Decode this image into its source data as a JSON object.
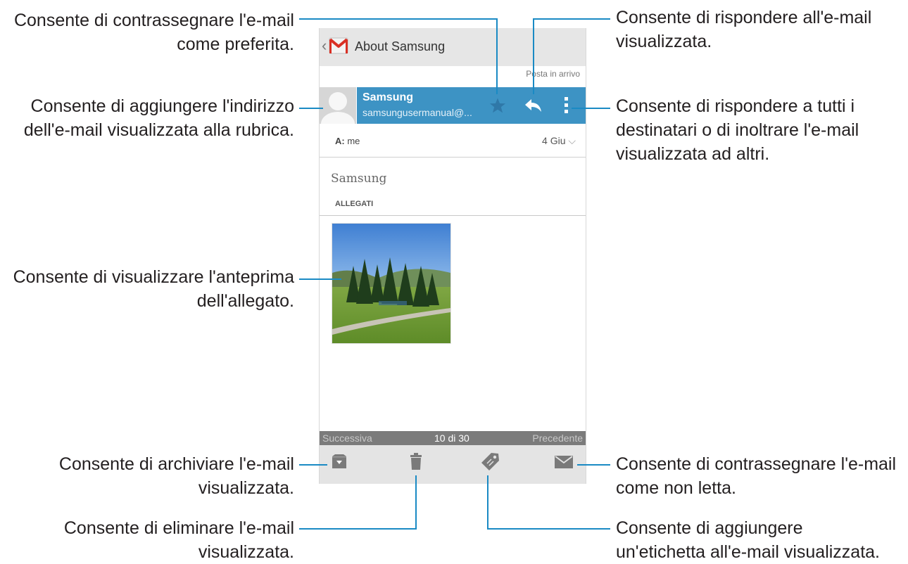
{
  "annotations": {
    "favorite": "Consente di contrassegnare l'e-mail\ncome preferita.",
    "add_contact": "Consente di aggiungere l'indirizzo\ndell'e-mail visualizzata alla rubrica.",
    "preview": "Consente di visualizzare l'anteprima\ndell'allegato.",
    "archive": "Consente di archiviare l'e-mail\nvisualizzata.",
    "delete": "Consente di eliminare l'e-mail\nvisualizzata.",
    "reply": "Consente di rispondere all'e-mail\nvisualizzata.",
    "more": "Consente di rispondere a tutti i\ndestinatari o di inoltrare l'e-mail\nvisualizzata ad altri.",
    "unread": "Consente di contrassegnare l'e-mail\ncome non letta.",
    "label": "Consente di aggiungere\nun'etichetta all'e-mail visualizzata."
  },
  "app": {
    "title": "About Samsung",
    "folder": "Posta in arrivo"
  },
  "message": {
    "sender_name": "Samsung",
    "sender_email": "samsungusermanual@...",
    "to_label": "A:",
    "to_value": "me",
    "date": "4 Giu",
    "subject": "Samsung",
    "attachments_header": "ALLEGATI"
  },
  "navigation": {
    "next": "Successiva",
    "count": "10 di 30",
    "previous": "Precedente"
  },
  "icons": {
    "back": "chevron-left-icon",
    "app_logo": "gmail-icon",
    "favorite": "star-icon",
    "reply": "reply-icon",
    "more": "overflow-menu-icon",
    "archive": "archive-icon",
    "delete": "trash-icon",
    "label": "tag-icon",
    "unread": "mark-unread-icon"
  },
  "colors": {
    "accent": "#3d93c4",
    "callout_line": "#1a8ac4",
    "action_bar": "#e6e6e6",
    "nav_bar": "#7b7b7b"
  }
}
